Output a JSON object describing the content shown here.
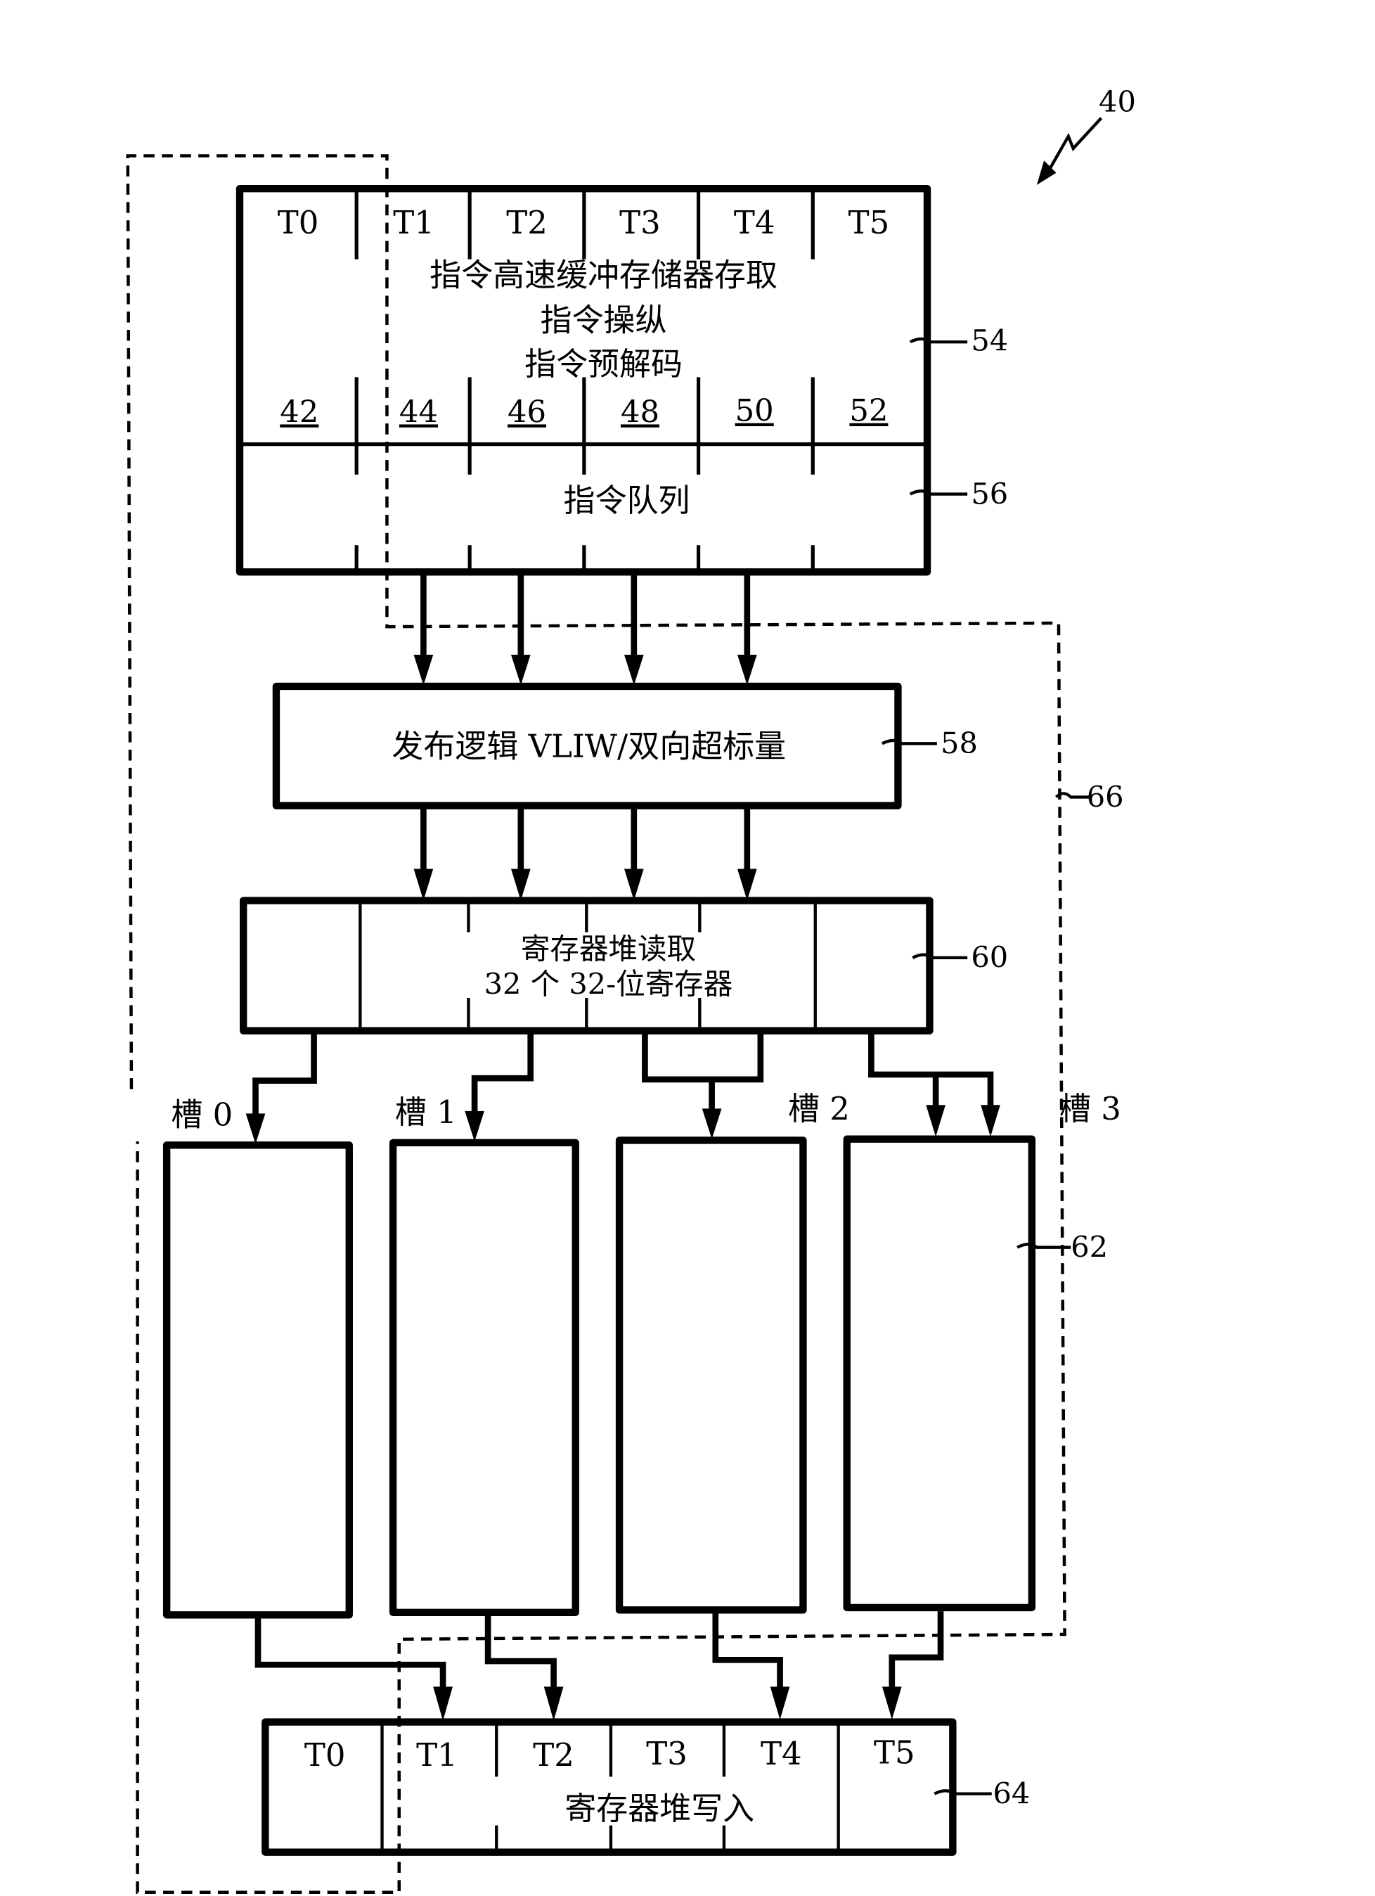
{
  "figure": {
    "ref_number": "40",
    "callouts": {
      "fetch_stage": "54",
      "queue_stage": "56",
      "issue_logic": "58",
      "reg_read": "60",
      "exec_units": "62",
      "reg_write": "64",
      "thread_group": "66"
    }
  },
  "fetch_box": {
    "threads": [
      "T0",
      "T1",
      "T2",
      "T3",
      "T4",
      "T5"
    ],
    "lines": [
      "指令高速缓冲存储器存取",
      "指令操纵",
      "指令预解码"
    ],
    "thread_refs": [
      "42",
      "44",
      "46",
      "48",
      "50",
      "52"
    ],
    "queue_label": "指令队列"
  },
  "issue_box": {
    "label": "发布逻辑 VLIW/双向超标量"
  },
  "reg_read_box": {
    "lines": [
      "寄存器堆读取",
      "32 个 32-位寄存器"
    ]
  },
  "slots": [
    "槽 0",
    "槽 1",
    "槽 2",
    "槽 3"
  ],
  "reg_write_box": {
    "threads": [
      "T0",
      "T1",
      "T2",
      "T3",
      "T4",
      "T5"
    ],
    "label": "寄存器堆写入"
  }
}
